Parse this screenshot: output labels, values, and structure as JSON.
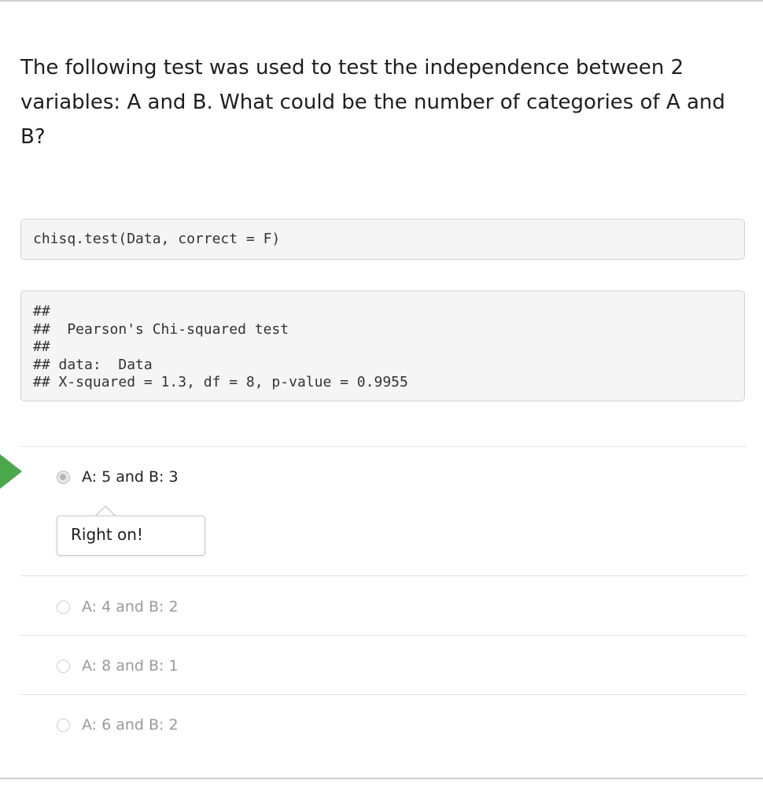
{
  "question": {
    "text": "The following test was used to test the independence between 2 variables: A and B. What could be the number of categories of A and B?"
  },
  "code": {
    "input": "chisq.test(Data, correct = F)",
    "output_lines": [
      "##",
      "##  Pearson's Chi-squared test",
      "##",
      "## data:  Data",
      "## X-squared = 1.3, df = 8, p-value = 0.9955"
    ]
  },
  "options": [
    {
      "label": "A: 5 and B: 3",
      "selected": true
    },
    {
      "label": "A: 4 and B: 2",
      "selected": false
    },
    {
      "label": "A: 8 and B: 1",
      "selected": false
    },
    {
      "label": "A: 6 and B: 2",
      "selected": false
    }
  ],
  "feedback": {
    "text": "Right on!"
  },
  "colors": {
    "correct_marker": "#4aa84a"
  }
}
